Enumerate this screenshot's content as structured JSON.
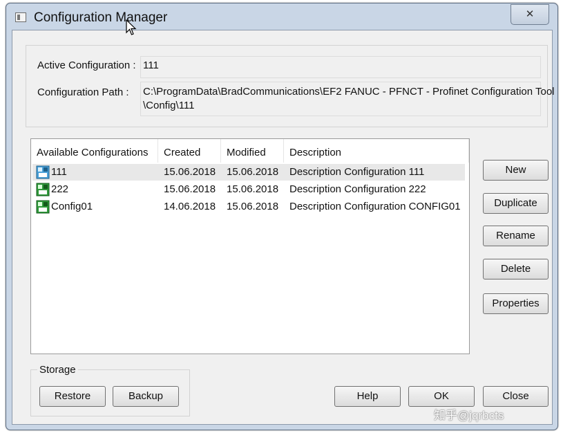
{
  "window": {
    "title": "Configuration Manager",
    "close_glyph": "✕"
  },
  "active_configuration": {
    "label": "Active Configuration :",
    "value": "111"
  },
  "configuration_path": {
    "label": "Configuration Path :",
    "line1": "C:\\ProgramData\\BradCommunications\\EF2 FANUC - PFNCT - Profinet Configuration Tool",
    "line2": "\\Config\\111"
  },
  "list": {
    "columns": [
      "Available Configurations",
      "Created",
      "Modified",
      "Description"
    ],
    "rows": [
      {
        "name": "111",
        "created": "15.06.2018",
        "modified": "15.06.2018",
        "description": "Description Configuration 111",
        "icon": "active-config-icon",
        "selected": true
      },
      {
        "name": "222",
        "created": "15.06.2018",
        "modified": "15.06.2018",
        "description": "Description Configuration 222",
        "icon": "config-icon",
        "selected": false
      },
      {
        "name": "Config01",
        "created": "14.06.2018",
        "modified": "15.06.2018",
        "description": "Description Configuration CONFIG01",
        "icon": "config-icon",
        "selected": false
      }
    ]
  },
  "side_buttons": {
    "new": "New",
    "duplicate": "Duplicate",
    "rename": "Rename",
    "delete": "Delete",
    "properties": "Properties"
  },
  "storage": {
    "label": "Storage",
    "restore": "Restore",
    "backup": "Backup"
  },
  "bottom_buttons": {
    "help": "Help",
    "ok": "OK",
    "close": "Close"
  },
  "watermark": "知乎@jqrbcts",
  "colors": {
    "active_icon": "#4aa0d8",
    "config_icon": "#2f9a3a"
  }
}
